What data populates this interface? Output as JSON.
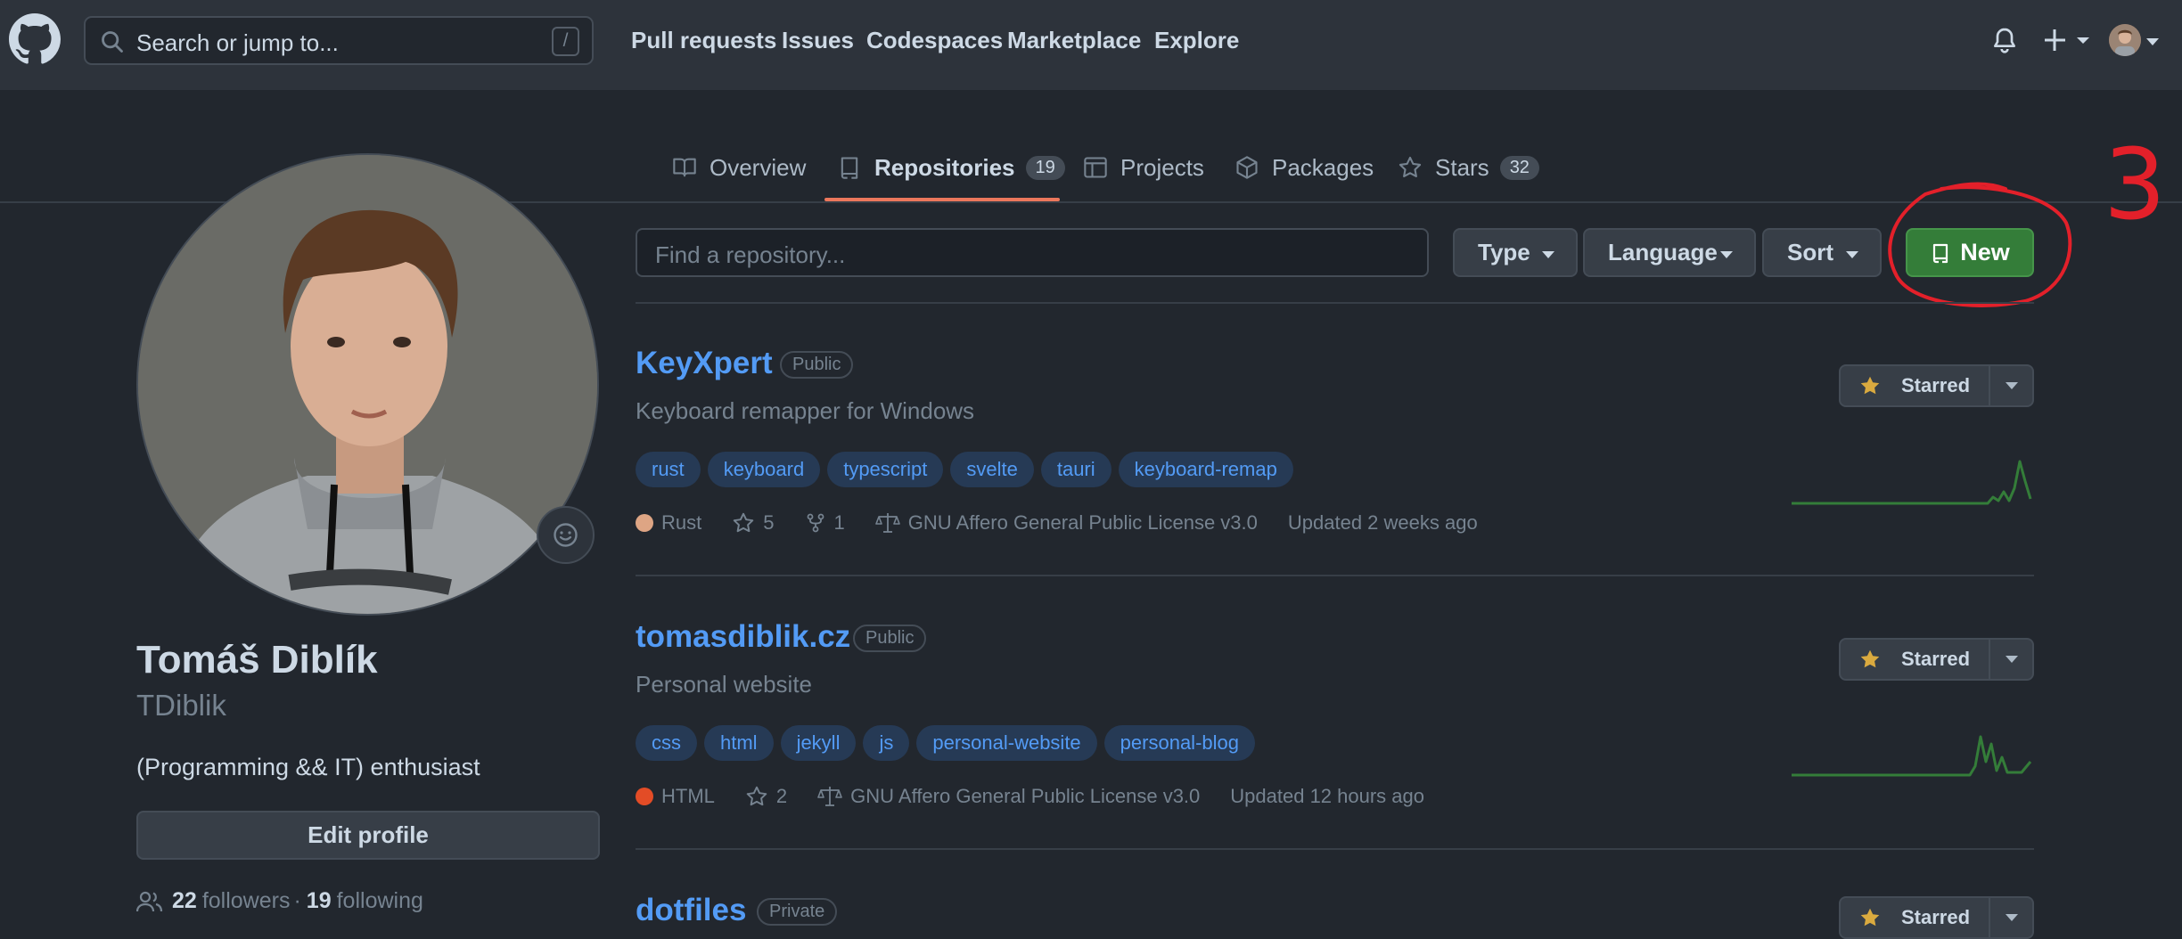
{
  "header": {
    "search_placeholder": "Search or jump to...",
    "search_shortcut": "/",
    "nav": [
      "Pull requests",
      "Issues",
      "Codespaces",
      "Marketplace",
      "Explore"
    ]
  },
  "tabs": [
    {
      "label": "Overview",
      "count": null
    },
    {
      "label": "Repositories",
      "count": "19"
    },
    {
      "label": "Projects",
      "count": null
    },
    {
      "label": "Packages",
      "count": null
    },
    {
      "label": "Stars",
      "count": "32"
    }
  ],
  "profile": {
    "name": "Tomáš Diblík",
    "login": "TDiblik",
    "bio": "(Programming && IT) enthusiast",
    "edit_label": "Edit profile",
    "followers": "22",
    "followers_label": "followers",
    "dot": "·",
    "following": "19",
    "following_label": "following"
  },
  "filter": {
    "placeholder": "Find a repository...",
    "type_label": "Type",
    "language_label": "Language",
    "sort_label": "Sort",
    "new_label": "New"
  },
  "annotation": {
    "text": "3",
    "color": "#e3202a"
  },
  "repos": [
    {
      "name": "KeyXpert",
      "visibility": "Public",
      "description": "Keyboard remapper for Windows",
      "topics": [
        "rust",
        "keyboard",
        "typescript",
        "svelte",
        "tauri",
        "keyboard-remap"
      ],
      "language": "Rust",
      "language_color": "#dea584",
      "stars": "5",
      "forks": "1",
      "license": "GNU Affero General Public License v3.0",
      "updated": "Updated 2 weeks ago",
      "star_label": "Starred"
    },
    {
      "name": "tomasdiblik.cz",
      "visibility": "Public",
      "description": "Personal website",
      "topics": [
        "css",
        "html",
        "jekyll",
        "js",
        "personal-website",
        "personal-blog"
      ],
      "language": "HTML",
      "language_color": "#e34c26",
      "stars": "2",
      "forks": null,
      "license": "GNU Affero General Public License v3.0",
      "updated": "Updated 12 hours ago",
      "star_label": "Starred"
    },
    {
      "name": "dotfiles",
      "visibility": "Private",
      "star_label": "Starred"
    }
  ],
  "colors": {
    "accent_green": "#347d39",
    "link_blue": "#539bf5",
    "tab_underline": "#ec775c"
  }
}
